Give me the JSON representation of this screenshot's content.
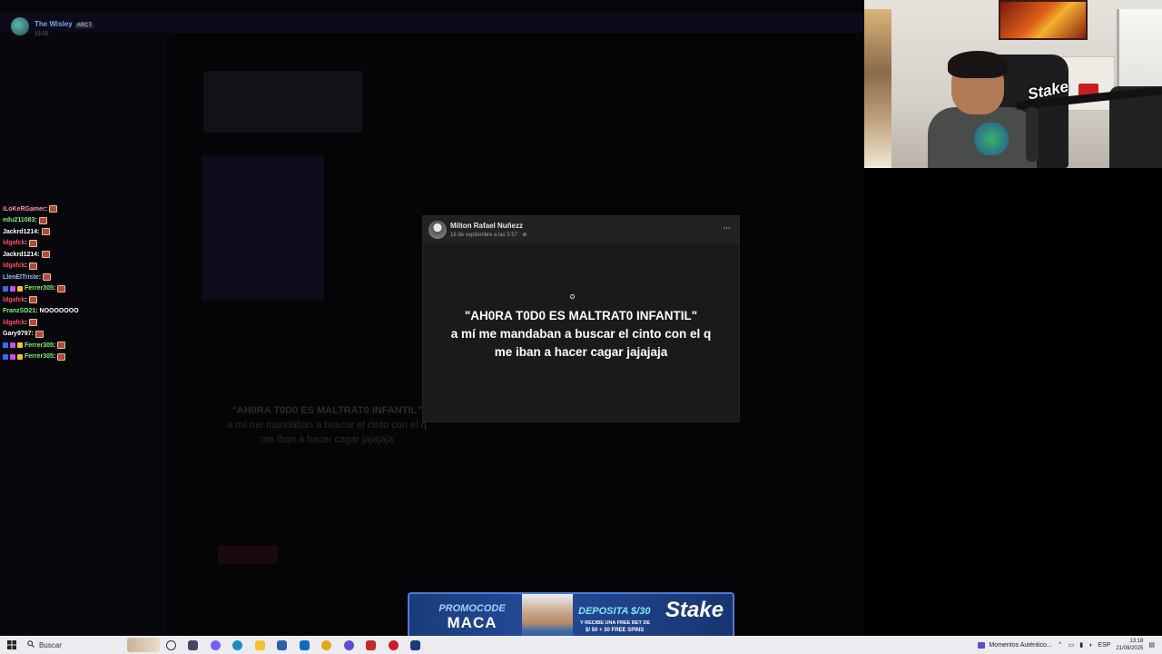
{
  "streamer": {
    "name": "The Wisley",
    "badge": "ARCT",
    "time": "15:05"
  },
  "chat": [
    {
      "user": "iLoKeRGamer",
      "color": "#ff8fa8",
      "msg": ""
    },
    {
      "user": "edu211083",
      "color": "#7cf07c",
      "msg": ""
    },
    {
      "user": "Jackrd1214",
      "color": "#ffffff",
      "msg": ""
    },
    {
      "user": "ldgafck",
      "color": "#ff4a6a",
      "msg": ""
    },
    {
      "user": "Jackrd1214",
      "color": "#ffffff",
      "msg": ""
    },
    {
      "user": "ldgafck",
      "color": "#ff4a6a",
      "msg": ""
    },
    {
      "user": "LlenElTriste",
      "color": "#8fc0ff",
      "msg": ""
    },
    {
      "user": "Ferrer305",
      "color": "#7cf07c",
      "msg": "",
      "badges": true
    },
    {
      "user": "ldgafck",
      "color": "#ff4a6a",
      "msg": ""
    },
    {
      "user": "FranzSD21",
      "color": "#7cf07c",
      "msg": "NOOOOOOO"
    },
    {
      "user": "ldgafck",
      "color": "#ff4a6a",
      "msg": ""
    },
    {
      "user": "Gary9797",
      "color": "#ffffff",
      "msg": ""
    },
    {
      "user": "Ferrer305",
      "color": "#7cf07c",
      "msg": "",
      "badges": true
    },
    {
      "user": "Ferrer305",
      "color": "#7cf07c",
      "msg": "",
      "badges": true
    }
  ],
  "post": {
    "author": "Milton Rafael Nuñezz",
    "date": "18 de septiembre a las 5:57 · ",
    "menu": "···",
    "line1": "\"AH0RA T0D0 ES MALTRAT0 INFANTIL\"",
    "line2": "a mí me mandaban a buscar el cinto con el q",
    "line3": "me iban a hacer cagar jajajaja"
  },
  "background_echo": {
    "line1": "\"AH0RA T0D0 ES MALTRAT0 INFANTIL\"",
    "line2": "a mí me mandaban a buscar el cinto con el q",
    "line3": "me iban a hacer cagar jajajaja"
  },
  "webcam": {
    "overlay": "Stake"
  },
  "banner": {
    "promo_label": "PROMOCODE",
    "promo_code": "MACA",
    "deposit": "DEPOSITA $/30",
    "sub1": "Y RECIBE UNA FREE BET DE",
    "sub2": "$/ 50 + 30 FREE SPINS",
    "logo": "Stake"
  },
  "taskbar": {
    "search": "Buscar",
    "tray_app": "Momentos Auténtico...",
    "lang": "ESP",
    "time": "13:18",
    "date": "21/09/2025",
    "apps": [
      {
        "name": "cortana",
        "color": "#333333"
      },
      {
        "name": "task-view",
        "color": "#444466"
      },
      {
        "name": "copilot",
        "color": "#7a5cff"
      },
      {
        "name": "edge",
        "color": "#1e88c8"
      },
      {
        "name": "explorer",
        "color": "#f2c230"
      },
      {
        "name": "store",
        "color": "#2b5fb0"
      },
      {
        "name": "outlook",
        "color": "#0f6cbd"
      },
      {
        "name": "chrome",
        "color": "#e2a81a"
      },
      {
        "name": "obs",
        "color": "#5a4fd0"
      },
      {
        "name": "app-red",
        "color": "#c02a2a"
      },
      {
        "name": "opera",
        "color": "#d01a2a"
      },
      {
        "name": "stake-app",
        "color": "#1b3a7a"
      }
    ]
  }
}
